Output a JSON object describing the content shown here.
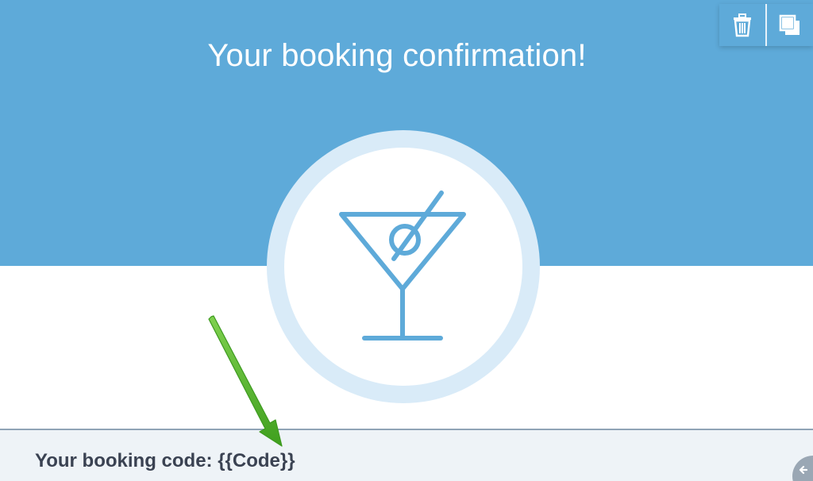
{
  "header": {
    "title": "Your booking confirmation!"
  },
  "toolbar": {
    "delete_icon": "trash-icon",
    "duplicate_icon": "copy-icon"
  },
  "hero_icon": "cocktail-glass-icon",
  "booking": {
    "code_text": "Your booking code: {{Code}}"
  },
  "annotation": {
    "arrow_icon": "green-arrow-icon"
  },
  "colors": {
    "hero_background": "#5eaad9",
    "icon_stroke": "#5eaad9",
    "circle_ring": "#d9ebf8",
    "code_bar_background": "#eef3f7",
    "code_text": "#3a4252",
    "arrow": "#4caf26"
  }
}
